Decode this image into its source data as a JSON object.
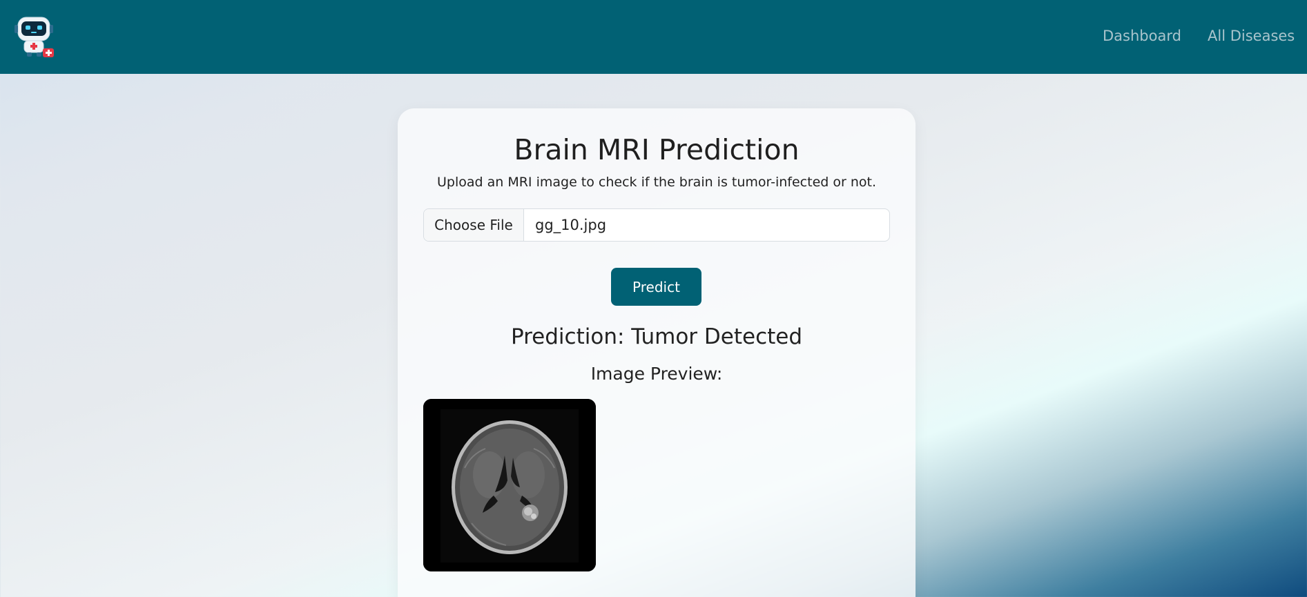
{
  "nav": {
    "logo_icon": "robot-doctor-icon",
    "links": [
      "Dashboard",
      "All Diseases"
    ]
  },
  "main": {
    "title": "Brain MRI Prediction",
    "subtitle": "Upload an MRI image to check if the brain is tumor-infected or not.",
    "file_input": {
      "button_label": "Choose File",
      "file_name": "gg_10.jpg"
    },
    "predict_label": "Predict",
    "prediction": "Prediction: Tumor Detected",
    "preview_label": "Image Preview:"
  },
  "colors": {
    "brand": "#016174",
    "nav_link": "#a9c4cc",
    "card_bg": "#fafbfc"
  }
}
